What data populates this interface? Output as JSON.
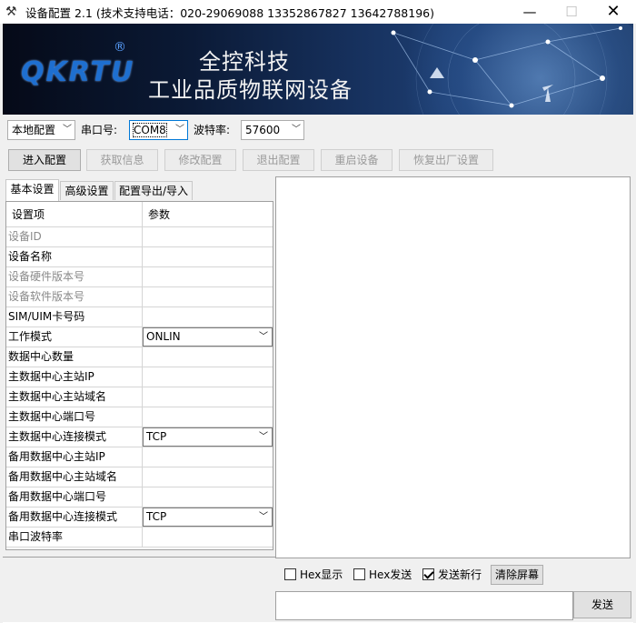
{
  "window": {
    "title": "设备配置 2.1 (技术支持电话：020-29069088  13352867827 13642788196)",
    "min": "—",
    "max": "☐",
    "close": "✕"
  },
  "banner": {
    "logo": "QKRTU",
    "logo_mark": "®",
    "slogan_line1": "全控科技",
    "slogan_line2": "工业品质物联网设备"
  },
  "toolbar": {
    "mode_value": "本地配置",
    "port_label": "串口号:",
    "port_value": "COM8",
    "baud_label": "波特率:",
    "baud_value": "57600",
    "buttons": [
      {
        "label": "进入配置",
        "enabled": true
      },
      {
        "label": "获取信息",
        "enabled": false
      },
      {
        "label": "修改配置",
        "enabled": false
      },
      {
        "label": "退出配置",
        "enabled": false
      },
      {
        "label": "重启设备",
        "enabled": false
      },
      {
        "label": "恢复出厂设置",
        "enabled": false
      }
    ]
  },
  "tabs": [
    "基本设置",
    "高级设置",
    "配置导出/导入"
  ],
  "grid": {
    "headers": [
      "设置项",
      "参数"
    ],
    "rows": [
      {
        "name": "设备ID",
        "value": "",
        "muted": true
      },
      {
        "name": "设备名称",
        "value": ""
      },
      {
        "name": "设备硬件版本号",
        "value": "",
        "muted": true
      },
      {
        "name": "设备软件版本号",
        "value": "",
        "muted": true
      },
      {
        "name": "SIM/UIM卡号码",
        "value": ""
      },
      {
        "name": "工作模式",
        "value": "ONLIN",
        "dropdown": true
      },
      {
        "name": "数据中心数量",
        "value": ""
      },
      {
        "name": "主数据中心主站IP",
        "value": ""
      },
      {
        "name": "主数据中心主站域名",
        "value": ""
      },
      {
        "name": "主数据中心端口号",
        "value": ""
      },
      {
        "name": "主数据中心连接模式",
        "value": "TCP",
        "dropdown": true
      },
      {
        "name": "备用数据中心主站IP",
        "value": ""
      },
      {
        "name": "备用数据中心主站域名",
        "value": ""
      },
      {
        "name": "备用数据中心端口号",
        "value": ""
      },
      {
        "name": "备用数据中心连接模式",
        "value": "TCP",
        "dropdown": true
      },
      {
        "name": "串口波特率",
        "value": ""
      }
    ]
  },
  "output": {
    "hex_display": "Hex显示",
    "hex_send": "Hex发送",
    "send_newline": "发送新行",
    "send_newline_checked": true,
    "clear": "清除屏幕",
    "send": "发送"
  },
  "colors": {
    "logo_blue": "#1e6fd0",
    "window_bg": "#f0f0f0"
  }
}
